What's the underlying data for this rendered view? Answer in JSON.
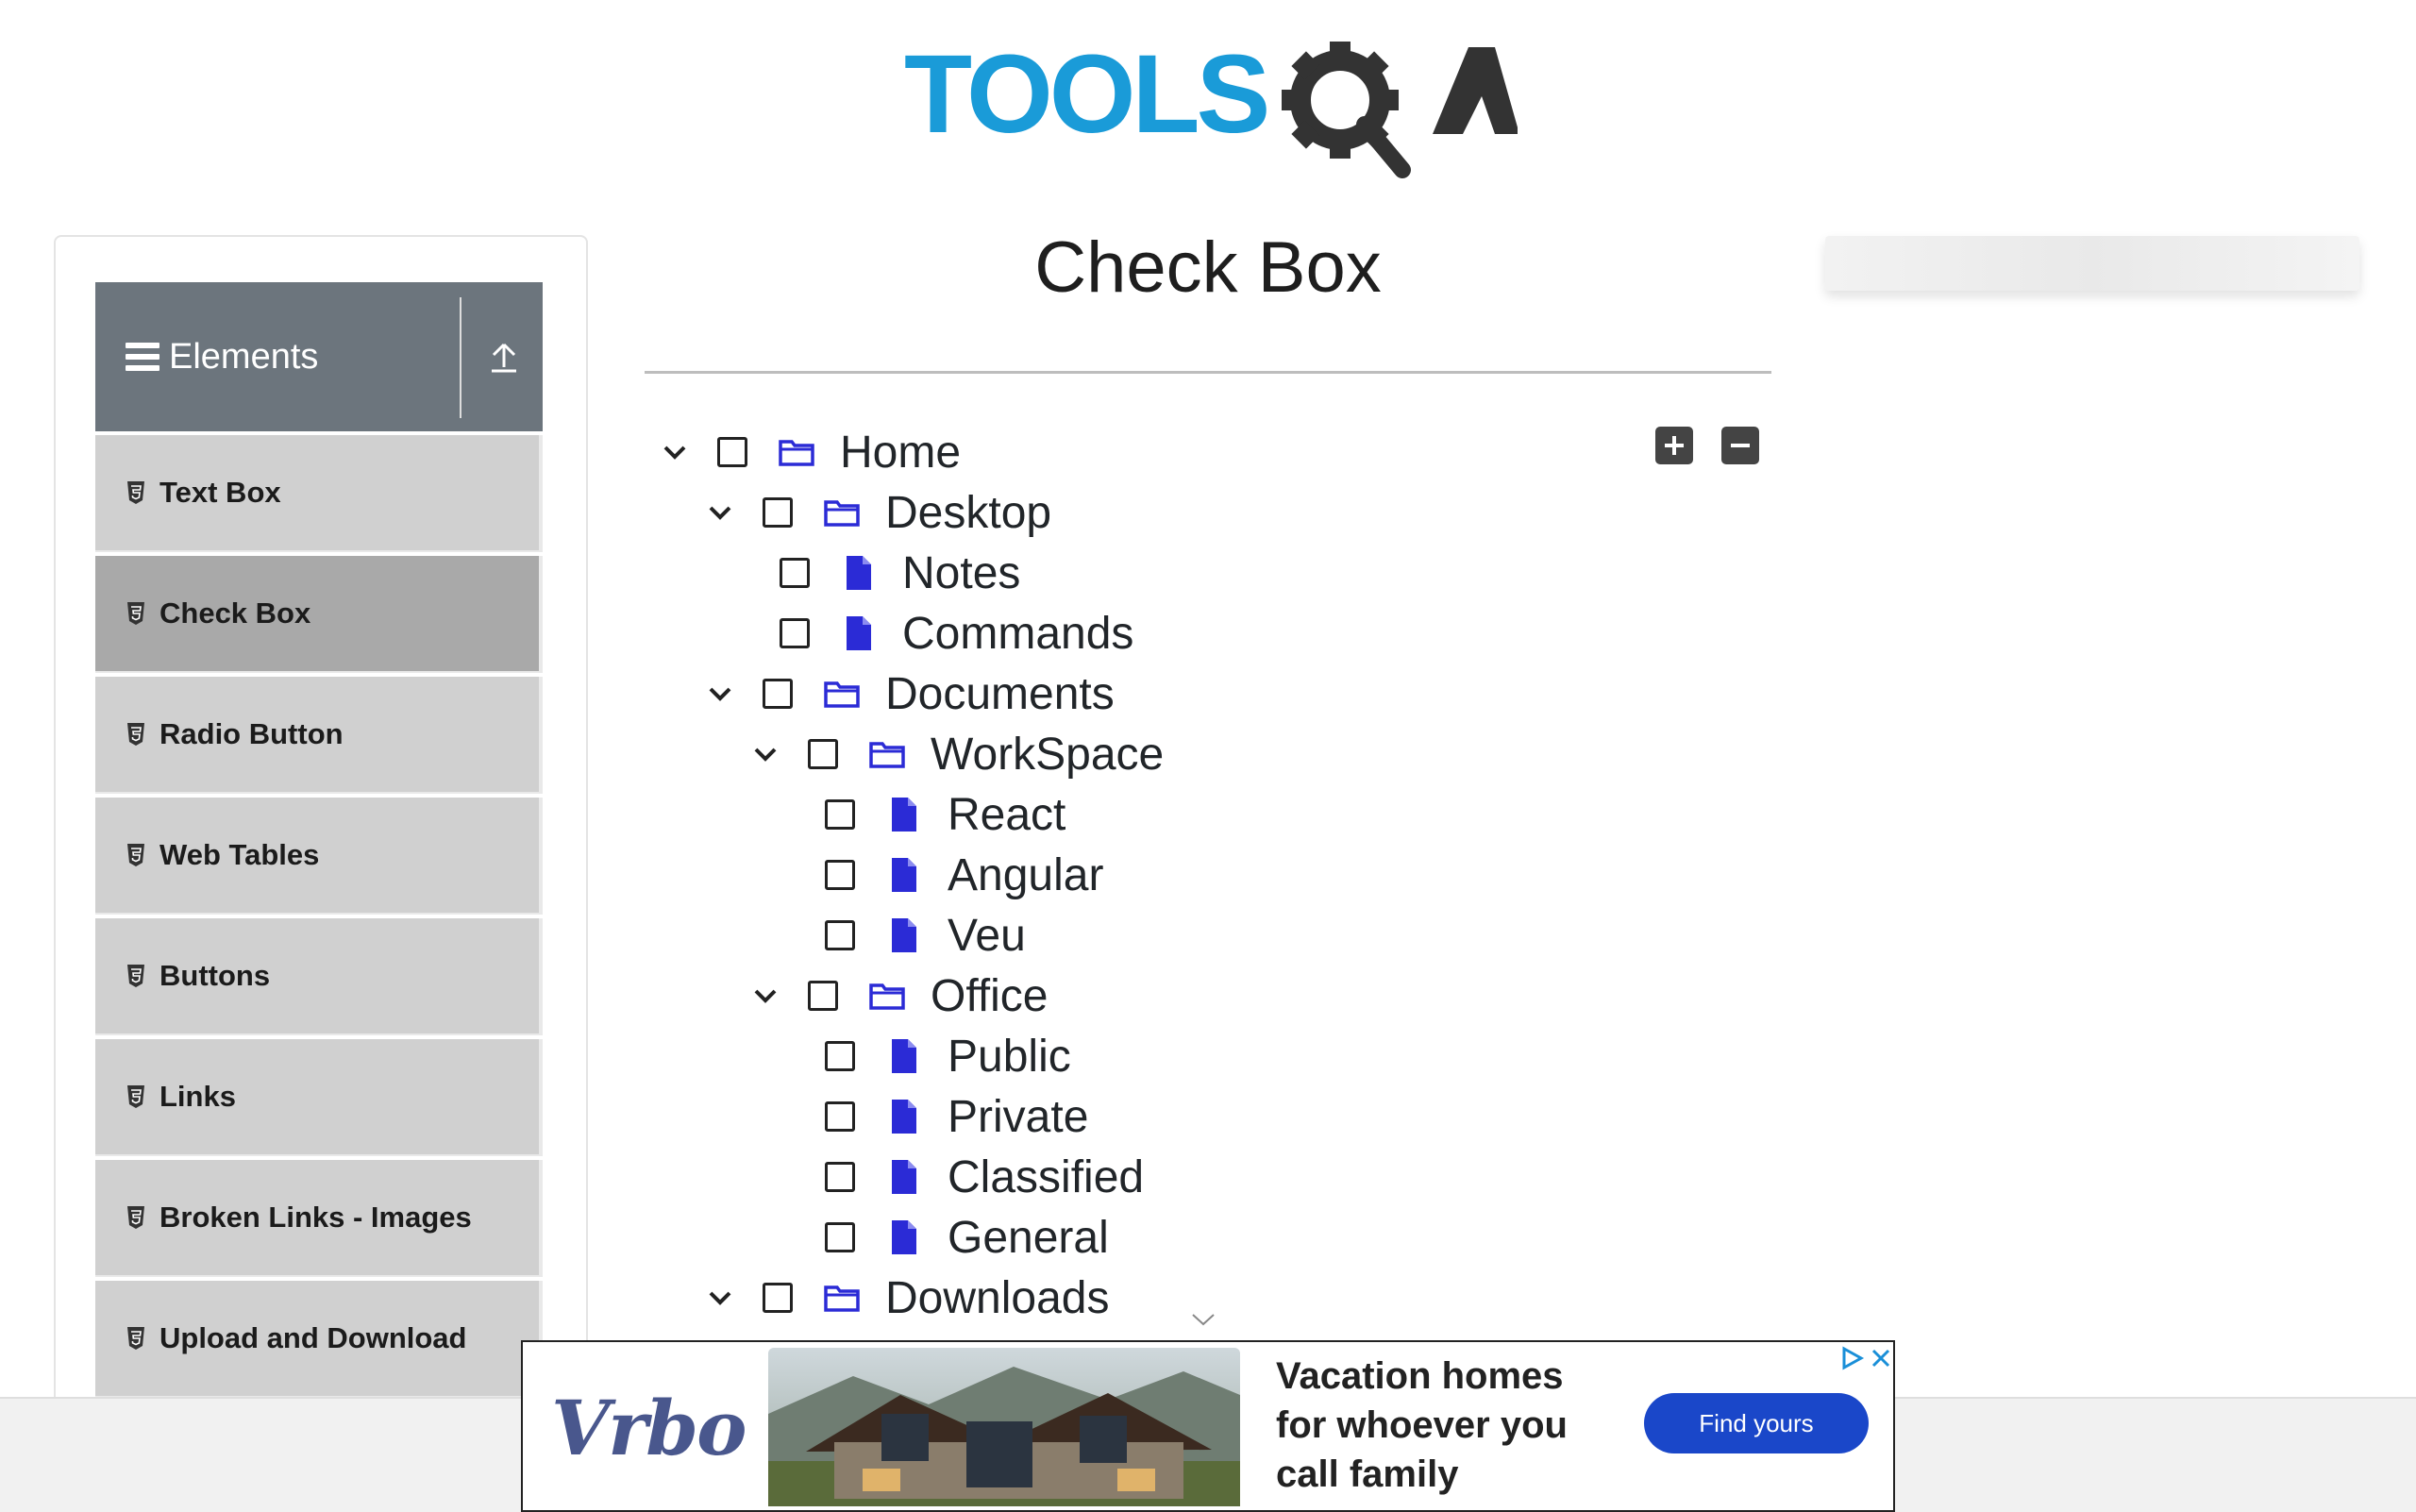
{
  "header": {
    "logo_text": "TOOLSQA"
  },
  "sidebar": {
    "group_title": "Elements",
    "items": [
      {
        "label": "Text Box",
        "active": false
      },
      {
        "label": "Check Box",
        "active": true
      },
      {
        "label": "Radio Button",
        "active": false
      },
      {
        "label": "Web Tables",
        "active": false
      },
      {
        "label": "Buttons",
        "active": false
      },
      {
        "label": "Links",
        "active": false
      },
      {
        "label": "Broken Links - Images",
        "active": false
      },
      {
        "label": "Upload and Download",
        "active": false
      }
    ]
  },
  "main": {
    "title": "Check Box",
    "tree": [
      {
        "label": "Home",
        "type": "folder",
        "expanded": true
      },
      {
        "label": "Desktop",
        "type": "folder",
        "expanded": true
      },
      {
        "label": "Notes",
        "type": "file"
      },
      {
        "label": "Commands",
        "type": "file"
      },
      {
        "label": "Documents",
        "type": "folder",
        "expanded": true
      },
      {
        "label": "WorkSpace",
        "type": "folder",
        "expanded": true
      },
      {
        "label": "React",
        "type": "file"
      },
      {
        "label": "Angular",
        "type": "file"
      },
      {
        "label": "Veu",
        "type": "file"
      },
      {
        "label": "Office",
        "type": "folder",
        "expanded": true
      },
      {
        "label": "Public",
        "type": "file"
      },
      {
        "label": "Private",
        "type": "file"
      },
      {
        "label": "Classified",
        "type": "file"
      },
      {
        "label": "General",
        "type": "file"
      },
      {
        "label": "Downloads",
        "type": "folder",
        "expanded": true
      }
    ]
  },
  "ad": {
    "brand": "Vrbo",
    "headline": [
      "Vacation homes",
      "for whoever you",
      "call family"
    ],
    "cta": "Find yours"
  },
  "colors": {
    "accent": "#2b2bd6",
    "sidebar_header": "#6c757d",
    "logo_blue": "#1a9bd8",
    "logo_dark": "#333333"
  }
}
